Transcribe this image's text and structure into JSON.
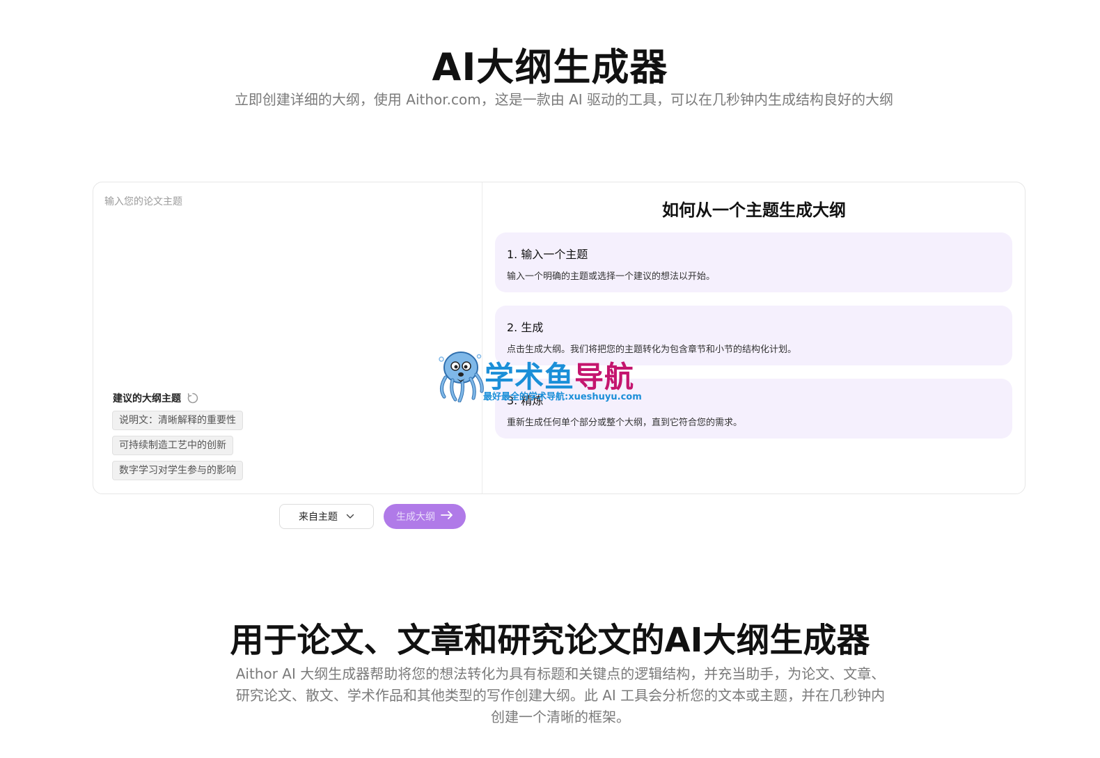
{
  "hero": {
    "title": "AI大纲生成器",
    "subtitle": "立即创建详细的大纲，使用 Aithor.com，这是一款由 AI 驱动的工具，可以在几秒钟内生成结构良好的大纲"
  },
  "input": {
    "placeholder": "输入您的论文主题",
    "value": ""
  },
  "suggestions": {
    "label": "建议的大纲主题",
    "items": [
      "说明文：清晰解释的重要性",
      "可持续制造工艺中的创新",
      "数字学习对学生参与的影响"
    ]
  },
  "how": {
    "title": "如何从一个主题生成大纲",
    "steps": [
      {
        "title": "1. 输入一个主题",
        "desc": "输入一个明确的主题或选择一个建议的想法以开始。"
      },
      {
        "title": "2. 生成",
        "desc": "点击生成大纲。我们将把您的主题转化为包含章节和小节的结构化计划。"
      },
      {
        "title": "3. 精炼",
        "desc": "重新生成任何单个部分或整个大纲，直到它符合您的需求。"
      }
    ]
  },
  "controls": {
    "mode_label": "来自主题",
    "generate_label": "生成大纲"
  },
  "watermark": {
    "brand_a": "学术鱼",
    "brand_b": "导航",
    "subtitle": "最好最全的学术导航:xueshuyu.com"
  },
  "section": {
    "title": "用于论文、文章和研究论文的AI大纲生成器",
    "subtitle": "Aithor AI 大纲生成器帮助将您的想法转化为具有标题和关键点的逻辑结构，并充当助手，为论文、文章、研究论文、散文、学术作品和其他类型的写作创建大纲。此 AI 工具会分析您的文本或主题，并在几秒钟内创建一个清晰的框架。"
  },
  "colors": {
    "accent": "#b07ae8",
    "step_bg": "#f5f0fd",
    "watermark_blue": "#1b8fd8",
    "watermark_magenta": "#c4156e"
  },
  "icons": {
    "refresh": "refresh-icon",
    "chevron": "chevron-down-icon",
    "arrow": "arrow-right-icon",
    "mascot": "octopus-mascot-icon"
  }
}
